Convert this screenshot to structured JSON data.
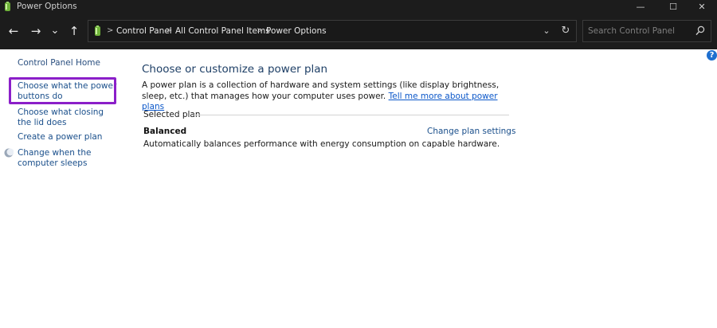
{
  "window": {
    "title": "Power Options",
    "minimize_glyph": "—",
    "maximize_glyph": "☐",
    "close_glyph": "✕"
  },
  "nav": {
    "back_glyph": "←",
    "forward_glyph": "→",
    "recent_glyph": "⌄",
    "up_glyph": "↑"
  },
  "address": {
    "crumbs": [
      "Control Panel",
      "All Control Panel Items",
      "Power Options"
    ],
    "separator": ">",
    "dropdown_glyph": "⌄",
    "refresh_glyph": "↻"
  },
  "search": {
    "placeholder": "Search Control Panel"
  },
  "help": {
    "label": "?"
  },
  "sidebar": {
    "items": [
      {
        "label": "Control Panel Home"
      },
      {
        "label": "Choose what the power buttons do",
        "highlighted": true
      },
      {
        "label": "Choose what closing the lid does"
      },
      {
        "label": "Create a power plan"
      },
      {
        "label": "Change when the computer sleeps",
        "icon": "moon-icon"
      }
    ],
    "highlight_color": "#8b1fc9"
  },
  "main": {
    "title": "Choose or customize a power plan",
    "description": "A power plan is a collection of hardware and system settings (like display brightness, sleep, etc.) that manages how your computer uses power.",
    "link": "Tell me more about power plans",
    "selected_label": "Selected plan",
    "plan": {
      "name": "Balanced",
      "description": "Automatically balances performance with energy consumption on capable hardware.",
      "change_link": "Change plan settings"
    }
  },
  "colors": {
    "chrome_bg": "#1c1c1c",
    "link": "#1a4f8b",
    "heading": "#1e3f66",
    "accent_help": "#1e6fcf"
  }
}
